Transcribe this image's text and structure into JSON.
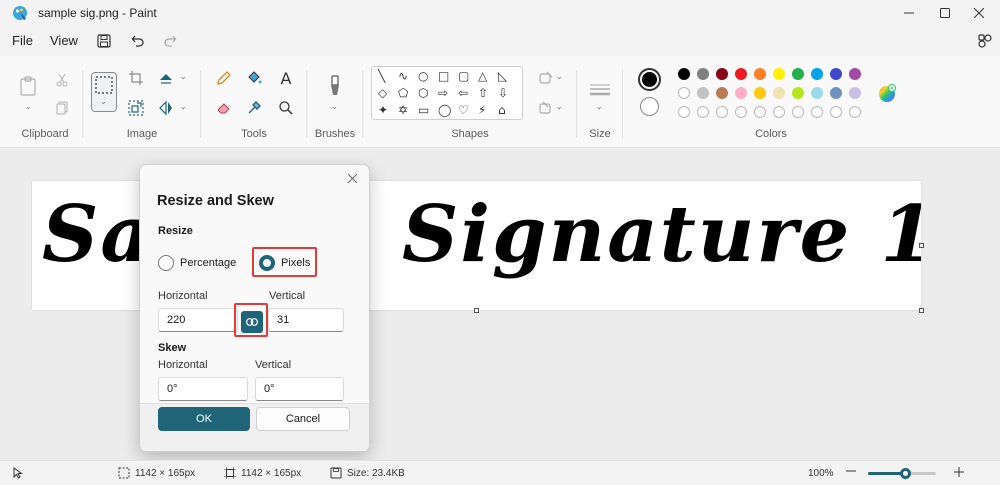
{
  "window": {
    "title": "sample sig.png - Paint",
    "minimize_icon": "minimize-icon",
    "maximize_icon": "maximize-icon",
    "close_icon": "close-icon"
  },
  "menu": {
    "file": "File",
    "view": "View"
  },
  "ribbon": {
    "groups": {
      "clipboard": "Clipboard",
      "image": "Image",
      "tools": "Tools",
      "brushes": "Brushes",
      "shapes": "Shapes",
      "size": "Size",
      "colors": "Colors"
    },
    "colors": {
      "primary": "#000000",
      "secondary": "#ffffff",
      "row1": [
        "#000000",
        "#7f7f7f",
        "#880015",
        "#ed1c24",
        "#ff7f27",
        "#fff200",
        "#22b14c",
        "#00a2e8",
        "#3f48cc",
        "#a349a4"
      ],
      "row2": [
        "#ffffff",
        "#c3c3c3",
        "#b97a57",
        "#ffaec9",
        "#ffc90e",
        "#efe4b0",
        "#b5e61d",
        "#99d9ea",
        "#7092be",
        "#c8bfe7"
      ],
      "row3_count": 10
    },
    "shapes_glyphs": [
      "╲",
      "∿",
      "○",
      "□",
      "▢",
      "△",
      "◺",
      "◇",
      "⬠",
      "⬡",
      "⇨",
      "⇦",
      "⇧",
      "⇩",
      "✦",
      "✡",
      "▭",
      "◯",
      "♡",
      "⚡",
      "⌂"
    ]
  },
  "canvas": {
    "signature_text_left": "Sa",
    "signature_text_right": "Signature 1"
  },
  "dialog": {
    "title": "Resize and Skew",
    "resize_section": "Resize",
    "percentage_label": "Percentage",
    "pixels_label": "Pixels",
    "selected_mode": "Pixels",
    "horizontal_label": "Horizontal",
    "vertical_label": "Vertical",
    "horizontal_value": "220",
    "vertical_value": "31",
    "maintain_aspect_ratio": true,
    "skew_section": "Skew",
    "skew_horizontal_label": "Horizontal",
    "skew_vertical_label": "Vertical",
    "skew_horizontal_value": "0°",
    "skew_vertical_value": "0°",
    "ok_label": "OK",
    "cancel_label": "Cancel",
    "accent": "#1f6577"
  },
  "status": {
    "selection_size": "1142 × 165px",
    "image_size": "1142 × 165px",
    "file_size": "Size: 23.4KB",
    "zoom": "100%",
    "zoom_fraction": 0.55
  }
}
